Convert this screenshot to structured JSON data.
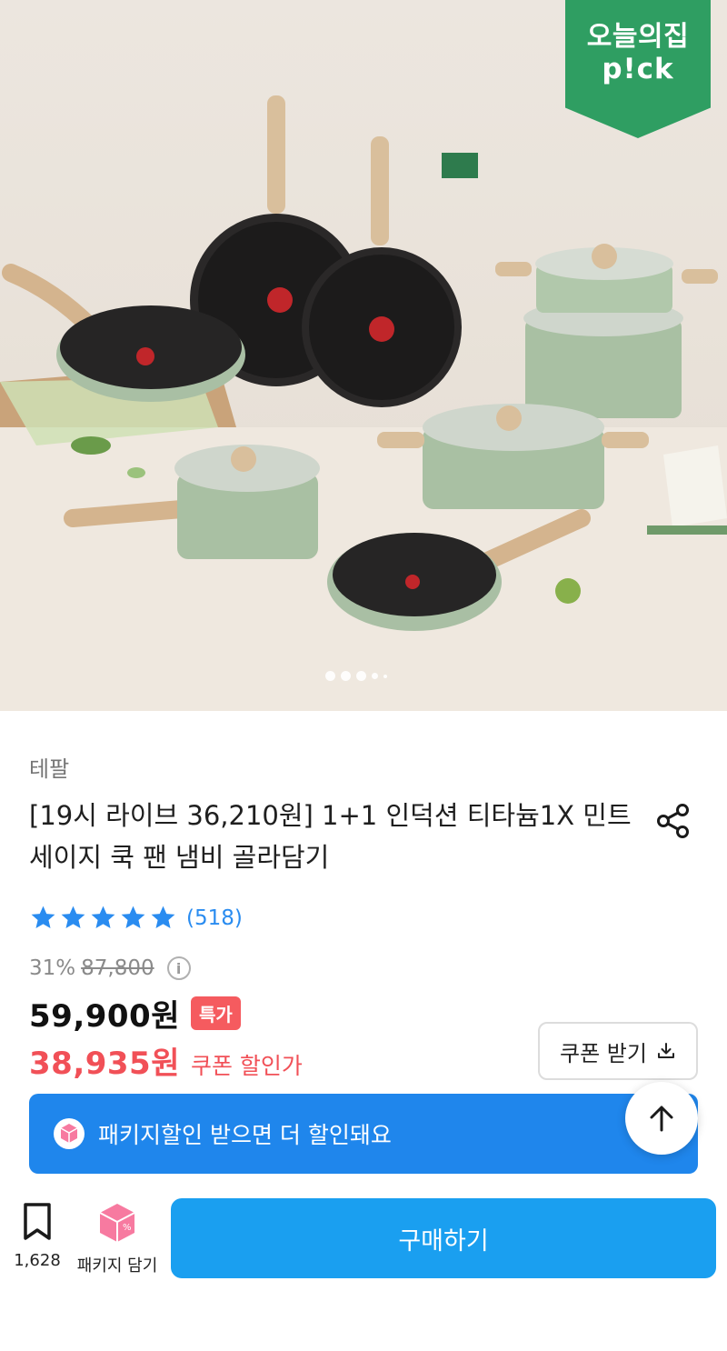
{
  "hero": {
    "badge_line1": "오늘의집",
    "badge_line2": "p!ck",
    "image_count": 5,
    "current_image": 1
  },
  "product": {
    "brand": "테팔",
    "title": "[19시 라이브 36,210원] 1+1 인덕션 티타늄1X 민트 세이지 쿡 팬 냄비 골라담기",
    "rating_stars": 5,
    "review_count": "(518)",
    "discount_rate": "31%",
    "original_price": "87,800",
    "sale_price": "59,900원",
    "special_tag": "특가",
    "coupon_price": "38,935원",
    "coupon_label": "쿠폰 할인가",
    "coupon_button": "쿠폰 받기"
  },
  "package_banner": {
    "text": "패키지할인 받으면 더 할인돼요"
  },
  "bottom_bar": {
    "bookmark_count": "1,628",
    "package_add_label": "패키지 담기",
    "buy_label": "구매하기"
  },
  "colors": {
    "pick_green": "#2f9e62",
    "price_red": "#f15057",
    "rating_blue": "#2a8cf0",
    "banner_blue": "#1f86ec",
    "buy_blue": "#1a9ff0",
    "pkg_pink": "#f77aa0"
  }
}
